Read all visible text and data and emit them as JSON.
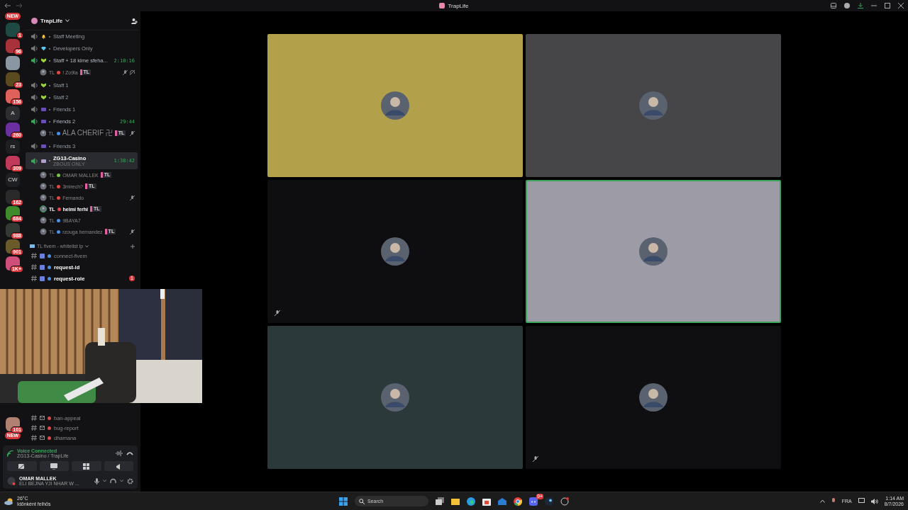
{
  "window": {
    "title": "TrapLife"
  },
  "rail": {
    "top_badge": "NEW",
    "servers": [
      {
        "badge": "1",
        "color": "#1f4a44"
      },
      {
        "badge": "96",
        "color": "#a8323a"
      },
      {
        "color": "#8a97a3"
      },
      {
        "badge": "23",
        "color": "#5b4a1e"
      },
      {
        "badge": "156",
        "color": "#e0605a"
      },
      {
        "label": "A",
        "color": "#2b2d31"
      },
      {
        "badge": "260",
        "color": "#6b2fa0"
      },
      {
        "label": "rs",
        "color": "#1e1f22"
      },
      {
        "badge": "309",
        "color": "#c23a5a"
      },
      {
        "label": "CW",
        "color": "#1e1f22"
      },
      {
        "badge": "162",
        "color": "#2a2a2a"
      },
      {
        "badge": "684",
        "color": "#3f8a2a"
      },
      {
        "badge": "988",
        "color": "#333a33"
      },
      {
        "badge": "901",
        "color": "#6a5a2a"
      },
      {
        "badge": "1K+",
        "color": "#d04f7a"
      }
    ],
    "bottom": {
      "badge": "101",
      "tag": "NEW",
      "color": "#b08070"
    }
  },
  "server": {
    "name": "TrapLife"
  },
  "voice_channels": [
    {
      "kind": "bell",
      "name": "Staff Meeting",
      "active": false
    },
    {
      "kind": "gem",
      "name": "Developers Only",
      "active": false
    },
    {
      "kind": "shield",
      "name": "Staff + 18 klme sfeha...",
      "active": true,
      "timer": "2:10:16",
      "members": [
        {
          "prefix": "TL",
          "color": "#e04848",
          "name": "! Zo9la",
          "tag": "TL",
          "speaking": false,
          "muted": true,
          "deafened": true
        }
      ]
    },
    {
      "kind": "shield",
      "name": "Staff 1",
      "active": false
    },
    {
      "kind": "shield",
      "name": "Staff 2",
      "active": false
    },
    {
      "kind": "people",
      "name": "Friends 1",
      "active": false
    },
    {
      "kind": "people",
      "name": "Friends 2",
      "active": true,
      "timer": "29:44",
      "members": [
        {
          "prefix": "TL",
          "color": "#4a90e2",
          "name": "ALA CHERIF 卍",
          "tag": "TL",
          "speaking": false,
          "muted": true,
          "deafened": false
        }
      ]
    },
    {
      "kind": "people",
      "name": "Friends 3",
      "active": false
    },
    {
      "kind": "box",
      "name": "ZG13-Casino",
      "subtitle": "ZBOUS ONLY",
      "active": true,
      "selected": true,
      "timer": "1:38:42",
      "members": [
        {
          "prefix": "TL",
          "color": "#7cc04b",
          "name": "OMAR MALLEK",
          "tag": "TL",
          "speaking": false,
          "muted": false,
          "deafened": false
        },
        {
          "prefix": "TL",
          "color": "#e04848",
          "name": "3mirech?",
          "tag": "TL",
          "speaking": false,
          "muted": false,
          "deafened": false
        },
        {
          "prefix": "TL",
          "color": "#e04848",
          "name": "Fernando",
          "speaking": false,
          "muted": true,
          "deafened": false
        },
        {
          "prefix": "TL",
          "color": "#e04848",
          "name": "helmi ferhi",
          "tag": "TL",
          "speaking": true,
          "muted": false,
          "deafened": false
        },
        {
          "prefix": "TL",
          "color": "#4a90e2",
          "name": "9BAYA7",
          "speaking": false,
          "muted": false,
          "deafened": false
        },
        {
          "prefix": "TL",
          "color": "#4a90e2",
          "name": "rzouga hernandez",
          "tag": "TL",
          "speaking": false,
          "muted": true,
          "deafened": false
        }
      ]
    }
  ],
  "category": {
    "name": "TL fivem - whitelist lp"
  },
  "text_channels": [
    {
      "name": "connect-fivem",
      "color": "#4a90e2",
      "unread": false
    },
    {
      "name": "request-id",
      "color": "#4a90e2",
      "unread": true
    },
    {
      "name": "request-role",
      "color": "#4a90e2",
      "unread": true,
      "badge": "1"
    }
  ],
  "lower_channels": [
    {
      "name": "ban-appeal",
      "color": "#e04848",
      "unread": false
    },
    {
      "name": "bug-report",
      "color": "#e04848",
      "unread": false
    },
    {
      "name": "dhamana",
      "color": "#e04848",
      "unread": false
    }
  ],
  "voice_panel": {
    "status": "Voice Connected",
    "location": "ZG13-Casino / TrapLife"
  },
  "user": {
    "name": "OMAR MALLEK",
    "status": "ELI BEJNA YJI NHAR W ..."
  },
  "tiles": [
    {
      "color": "#b2a04a",
      "speaking": false,
      "muted": false
    },
    {
      "color": "#464648",
      "speaking": false,
      "muted": false
    },
    {
      "color": "#0e0e10",
      "speaking": false,
      "muted": true
    },
    {
      "color": "#9d9ca6",
      "speaking": true,
      "muted": false
    },
    {
      "color": "#2c393a",
      "speaking": false,
      "muted": false
    },
    {
      "color": "#0f0f11",
      "speaking": false,
      "muted": true
    }
  ],
  "taskbar": {
    "weather": {
      "temp": "26°C",
      "text": "Időnként felhős"
    },
    "search": {
      "placeholder": "Search"
    },
    "discord_badge": "9+",
    "language": "FRA",
    "time": "1:14 AM",
    "date": "8/7/2026"
  }
}
